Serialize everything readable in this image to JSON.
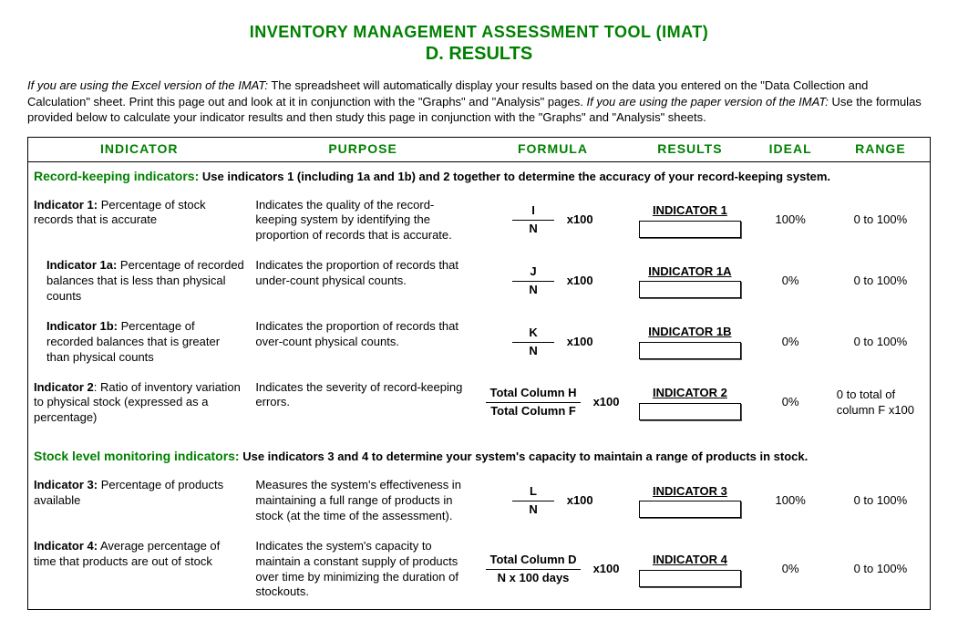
{
  "title": {
    "main": "INVENTORY MANAGEMENT ASSESSMENT TOOL (IMAT)",
    "sub": "D. RESULTS"
  },
  "intro": {
    "part1_italic": "If you are using the Excel version of the IMAT:",
    "part1_text": " The spreadsheet will automatically display your results based on the data you entered on the \"Data Collection and Calculation\" sheet. Print this page out and look at it in conjunction with the \"Graphs\" and \"Analysis\" pages. ",
    "part2_italic": "If you are using the paper version of the IMAT:",
    "part2_text": " Use the formulas provided below to calculate your indicator results and then study this page in conjunction with the \"Graphs\" and \"Analysis\" sheets."
  },
  "headers": {
    "indicator": "INDICATOR",
    "purpose": "PURPOSE",
    "formula": "FORMULA",
    "results": "RESULTS",
    "ideal": "IDEAL",
    "range": "RANGE"
  },
  "sections": [
    {
      "label": "Record-keeping indicators:",
      "note": " Use indicators 1 (including 1a and 1b) and 2 together to determine the accuracy of your record-keeping system."
    },
    {
      "label": "Stock level monitoring indicators:",
      "note": " Use indicators 3 and 4 to determine your system's capacity to maintain a range of products in stock."
    }
  ],
  "rows": [
    {
      "name": "Indicator 1:",
      "desc": " Percentage of stock records that is accurate",
      "purpose": "Indicates the quality of the record-keeping system by identifying the proportion of records that is accurate.",
      "frac_num": "I",
      "frac_den": "N",
      "mult": "x100",
      "result_label": "INDICATOR 1",
      "ideal": "100%",
      "range": "0 to 100%",
      "indent": false
    },
    {
      "name": "Indicator 1a:",
      "desc": "  Percentage of recorded balances that is less than physical counts",
      "purpose": "Indicates the proportion of records that under-count physical counts.",
      "frac_num": "J",
      "frac_den": "N",
      "mult": "x100",
      "result_label": "INDICATOR 1A",
      "ideal": "0%",
      "range": "0 to 100%",
      "indent": true
    },
    {
      "name": "Indicator 1b:",
      "desc": " Percentage of recorded balances that is greater than physical counts",
      "purpose": "Indicates the proportion of records that over-count physical counts.",
      "frac_num": "K",
      "frac_den": "N",
      "mult": "x100",
      "result_label": "INDICATOR 1B",
      "ideal": "0%",
      "range": "0 to 100%",
      "indent": true
    },
    {
      "name": "Indicator 2",
      "desc": ": Ratio of inventory variation to physical stock (expressed as a percentage)",
      "purpose": "Indicates the severity of record-keeping errors.",
      "frac_num": "Total Column H",
      "frac_den": "Total Column F",
      "mult": "x100",
      "result_label": "INDICATOR 2",
      "ideal": "0%",
      "range": "0 to total of column F x100",
      "indent": false
    },
    {
      "name": "Indicator 3:",
      "desc": " Percentage of products available",
      "purpose": "Measures the system's effectiveness in maintaining a full range of products in stock (at the time of the assessment).",
      "frac_num": "L",
      "frac_den": "N",
      "mult": "x100",
      "result_label": "INDICATOR 3",
      "ideal": "100%",
      "range": "0 to 100%",
      "indent": false
    },
    {
      "name": "Indicator 4:",
      "desc": " Average percentage of time that products are out of stock",
      "purpose": "Indicates the system's capacity to maintain a constant supply of products over time by minimizing the duration of stockouts.",
      "frac_num": "Total Column D",
      "frac_den": "N x 100 days",
      "mult": "x100",
      "result_label": "INDICATOR 4",
      "ideal": "0%",
      "range": "0 to 100%",
      "indent": false
    }
  ]
}
